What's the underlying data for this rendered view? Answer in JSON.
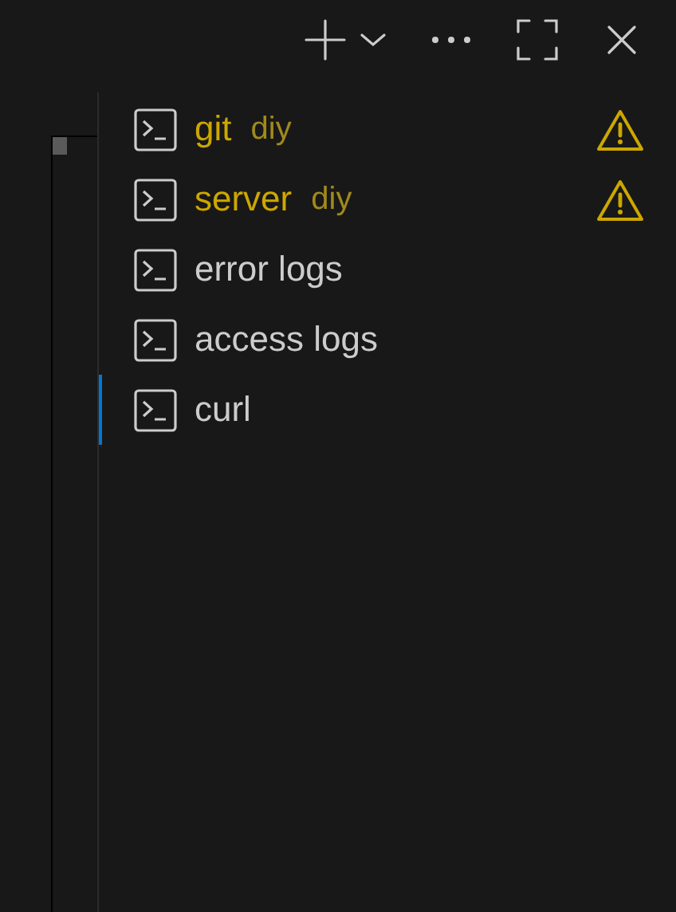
{
  "toolbar": {
    "actions": [
      {
        "kind": "new"
      },
      {
        "kind": "dropdown"
      },
      {
        "kind": "more"
      },
      {
        "kind": "maximize"
      },
      {
        "kind": "close"
      }
    ]
  },
  "terminals": [
    {
      "name": "git",
      "description": "diy",
      "warning": true,
      "selected": false
    },
    {
      "name": "server",
      "description": "diy",
      "warning": true,
      "selected": false
    },
    {
      "name": "error logs",
      "warning": false,
      "selected": false
    },
    {
      "name": "access logs",
      "warning": false,
      "selected": false
    },
    {
      "name": "curl",
      "warning": false,
      "selected": true
    }
  ]
}
